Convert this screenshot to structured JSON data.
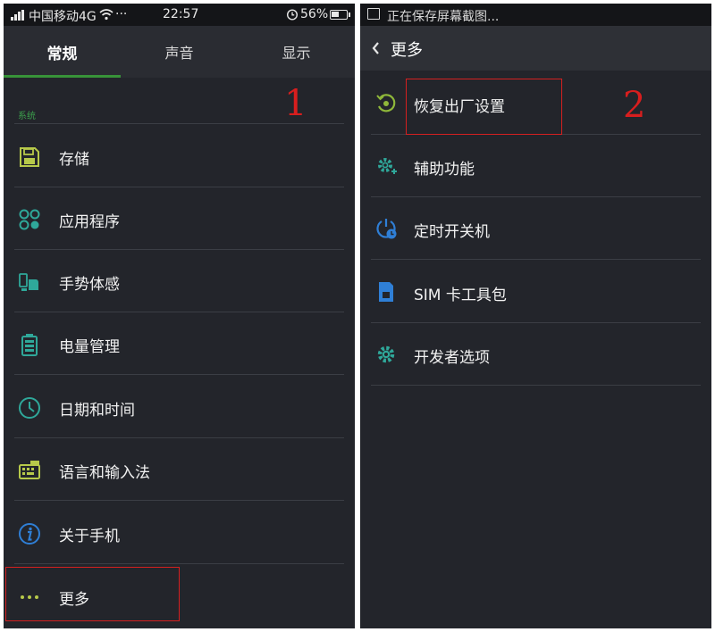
{
  "left_screen": {
    "status_bar": {
      "carrier": "中国移动4G",
      "dots": "···",
      "time": "22:57",
      "battery": "56%",
      "battery_level": 0.56
    },
    "tabs": [
      {
        "label": "常规",
        "active": true
      },
      {
        "label": "声音",
        "active": false
      },
      {
        "label": "显示",
        "active": false
      }
    ],
    "section_label": "系统",
    "items": [
      {
        "label": "存储",
        "icon": "storage-icon"
      },
      {
        "label": "应用程序",
        "icon": "apps-icon"
      },
      {
        "label": "手势体感",
        "icon": "gesture-icon"
      },
      {
        "label": "电量管理",
        "icon": "battery-icon"
      },
      {
        "label": "日期和时间",
        "icon": "clock-icon"
      },
      {
        "label": "语言和输入法",
        "icon": "keyboard-icon"
      },
      {
        "label": "关于手机",
        "icon": "info-icon"
      },
      {
        "label": "更多",
        "icon": "more-icon"
      }
    ]
  },
  "right_screen": {
    "notification": "正在保存屏幕截图...",
    "header_title": "更多",
    "items": [
      {
        "label": "恢复出厂设置",
        "icon": "factory-reset-icon"
      },
      {
        "label": "辅助功能",
        "icon": "accessibility-icon"
      },
      {
        "label": "定时开关机",
        "icon": "scheduled-power-icon"
      },
      {
        "label": "SIM 卡工具包",
        "icon": "sim-card-icon"
      },
      {
        "label": "开发者选项",
        "icon": "developer-options-icon"
      }
    ]
  },
  "annotations": {
    "step1": "1",
    "step2": "2"
  },
  "colors": {
    "background": "#23252b",
    "accent_green": "#3c9e4c",
    "icon_teal": "#2fa89a",
    "icon_blue": "#2f7fd6",
    "annotation_red": "#d42020"
  }
}
